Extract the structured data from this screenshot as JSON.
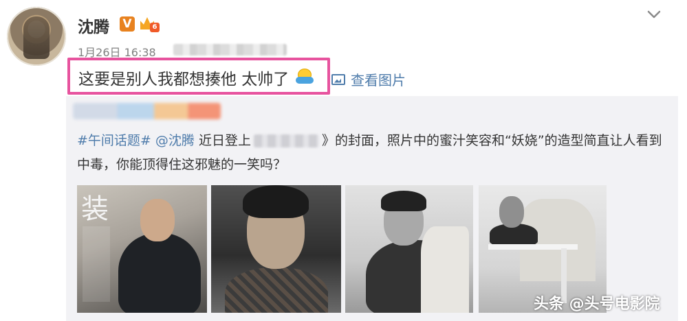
{
  "post": {
    "username": "沈腾",
    "verified_badge": "V",
    "vip_level": "6",
    "timestamp": "1月26日 16:38",
    "text": "这要是别人我都想揍他 太帅了",
    "view_image_label": "查看图片"
  },
  "repost": {
    "topic_tag": "#午间话题#",
    "mention": "@沈腾",
    "text_before_title": " 近日登上",
    "text_after_title": "》的封面，照片中的蜜汁笑容和“妖娆”的造型简直让人看到中毒，你能顶得住这邪魅的一笑吗？",
    "cover_masthead": "装"
  },
  "photos": [
    {
      "name": "magazine-cover"
    },
    {
      "name": "portrait-close-up"
    },
    {
      "name": "portrait-leaning"
    },
    {
      "name": "portrait-table"
    }
  ],
  "watermark": "头条 @头号电影院",
  "colors": {
    "highlight_border": "#e7539e",
    "link": "#4f7cab",
    "repost_background": "#f2f2f5",
    "verified": "#e8821f"
  },
  "icons": [
    "chevron-down-icon",
    "verified-icon",
    "vip-crown-icon",
    "hug-emoji-icon",
    "image-icon"
  ]
}
